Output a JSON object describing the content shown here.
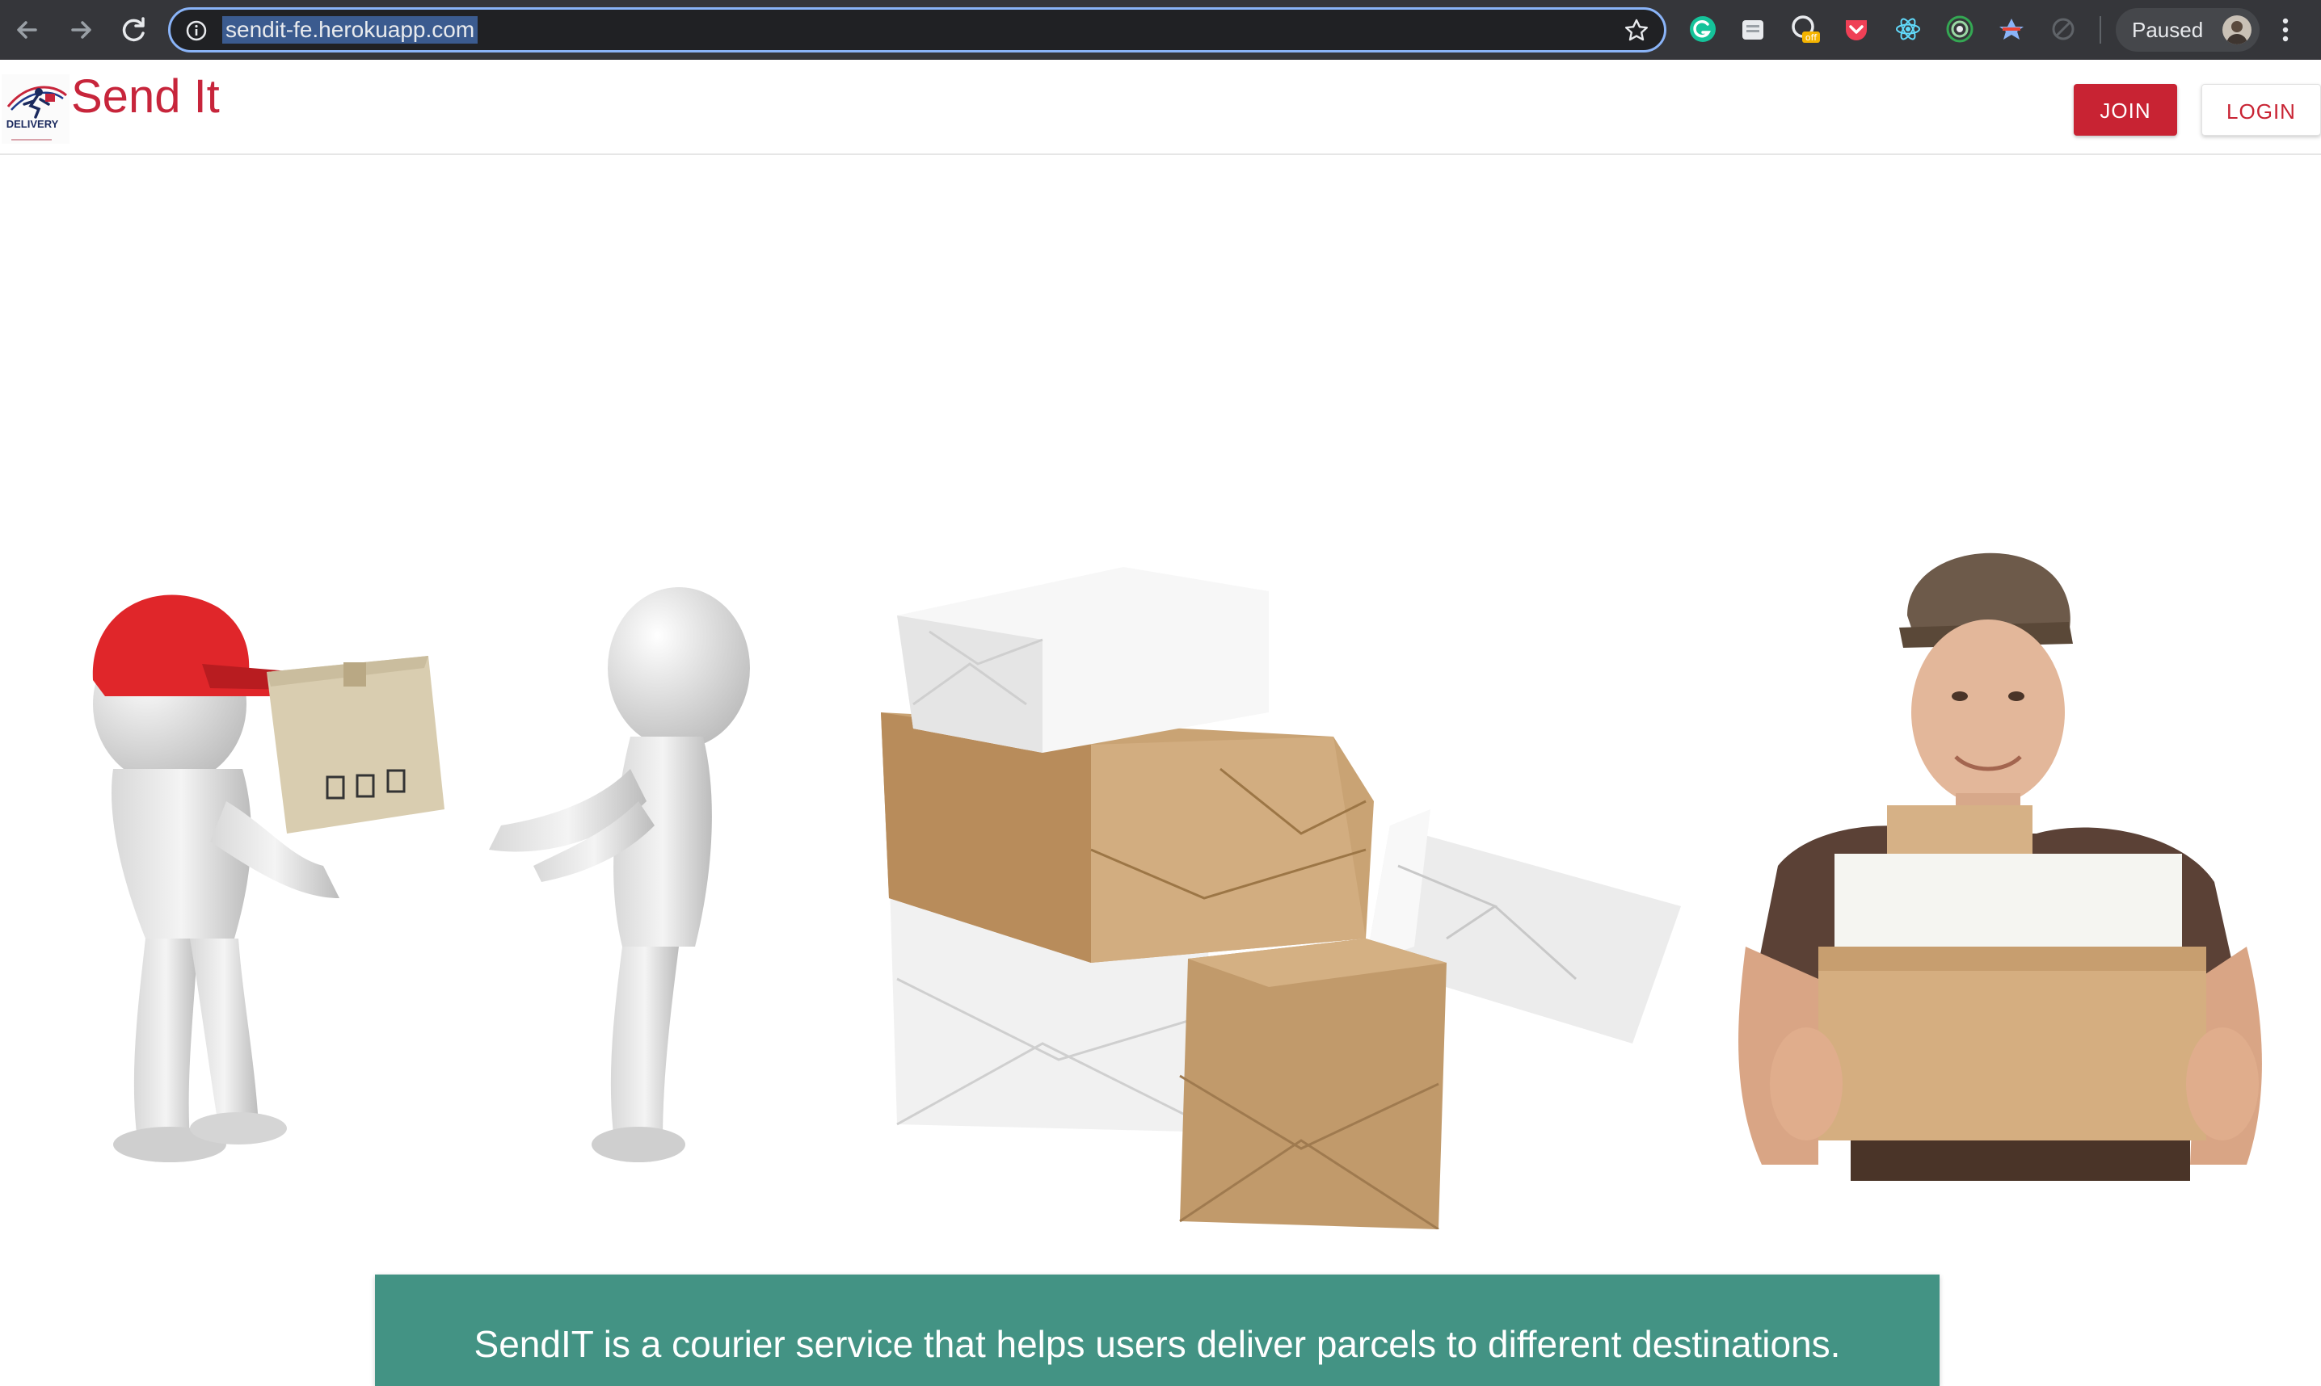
{
  "browser": {
    "url": "sendit-fe.herokuapp.com",
    "profile_label": "Paused",
    "extension_badge": "off",
    "icons": [
      "back-icon",
      "forward-icon",
      "reload-icon",
      "info-icon",
      "star-icon",
      "grammarly-icon",
      "extension-icon",
      "screen-capture-icon",
      "pocket-icon",
      "react-devtools-icon",
      "target-icon",
      "translate-icon",
      "sync-icon",
      "menu-icon"
    ],
    "colors": {
      "toolbar": "#35363a",
      "omnibox": "#202124",
      "focus_ring": "#8ab4f8"
    }
  },
  "header": {
    "logo_text": "DELIVERY",
    "brand": "Send It",
    "join_label": "JOIN",
    "login_label": "LOGIN",
    "colors": {
      "brand": "#c7253b",
      "join_bg": "#c82333"
    }
  },
  "hero": {
    "images": [
      "stick-figures-handing-box",
      "stack-of-parcels",
      "delivery-man-holding-boxes"
    ]
  },
  "banner": {
    "text": "SendIT is a courier service that helps users deliver parcels to different destinations.",
    "color": "#439384"
  }
}
